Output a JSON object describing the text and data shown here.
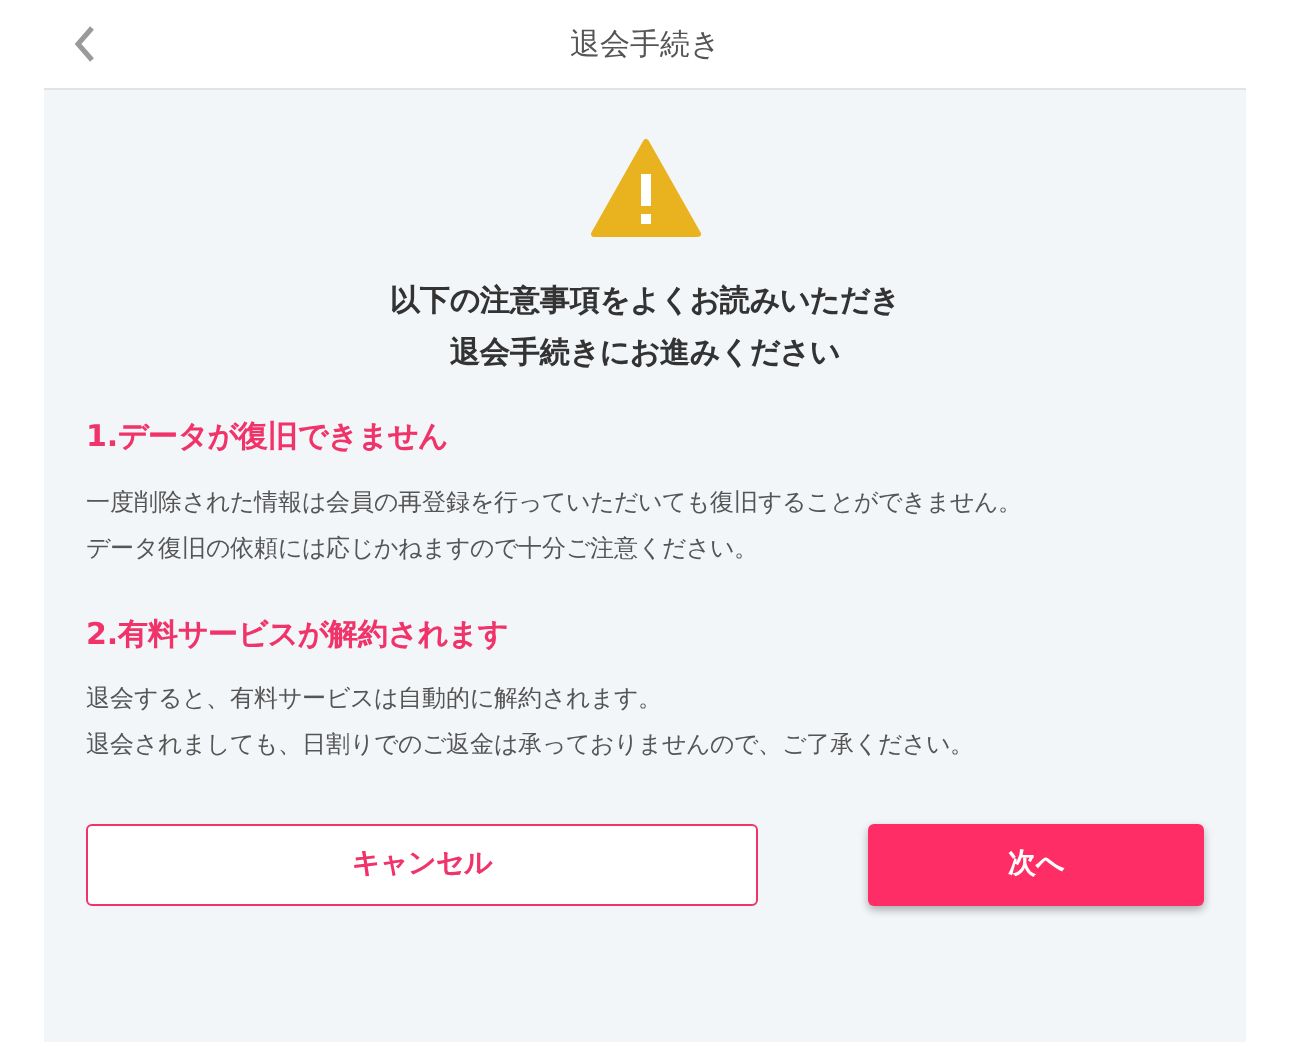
{
  "header": {
    "title": "退会手続き"
  },
  "notice": {
    "lines": [
      "以下の注意事項をよくお読みいただき",
      "退会手続きにお進みください"
    ]
  },
  "sections": [
    {
      "heading": "1.データが復旧できません",
      "lines": [
        "一度削除された情報は会員の再登録を行っていただいても復旧することができません。",
        "データ復旧の依頼には応じかねますので十分ご注意ください。"
      ]
    },
    {
      "heading": "2.有料サービスが解約されます",
      "lines": [
        "退会すると、有料サービスは自動的に解約されます。",
        "退会されましても、日割りでのご返金は承っておりませんので、ご了承ください。"
      ]
    }
  ],
  "buttons": [
    {
      "label": "キャンセル",
      "kind": "secondary"
    },
    {
      "label": "次へ",
      "kind": "primary"
    }
  ]
}
